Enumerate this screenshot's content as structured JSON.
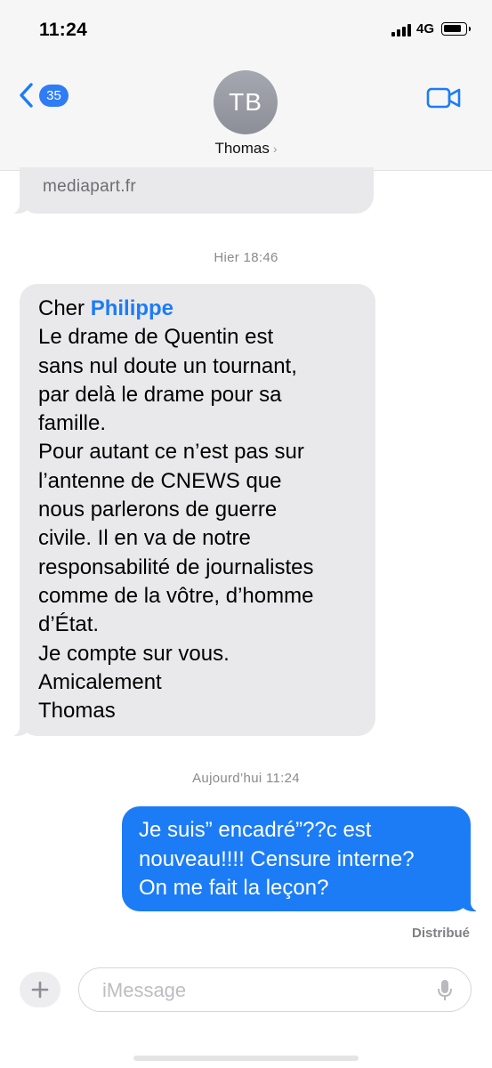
{
  "status_bar": {
    "time": "11:24",
    "network": "4G"
  },
  "header": {
    "back_count": "35",
    "avatar_initials": "TB",
    "contact_name": "Thomas",
    "chevron": "›"
  },
  "messages": {
    "previous_link": "mediapart.fr",
    "timestamp_1": "Hier 18:46",
    "msg1_greeting": "Cher ",
    "msg1_mention": "Philippe",
    "msg1_body": "Le drame de Quentin est\nsans nul doute un tournant,\npar delà le drame pour sa\nfamille.\nPour autant ce n’est pas sur\nl’antenne de CNEWS que\nnous parlerons de guerre\ncivile. Il en va de notre\nresponsabilité de journalistes\ncomme de la vôtre, d’homme\nd’État.\nJe compte sur vous.\nAmicalement\nThomas",
    "timestamp_2": "Aujourd’hui 11:24",
    "msg2_body": "Je suis” encadré”??c est\nnouveau!!!! Censure interne?\nOn me fait la leçon?",
    "delivery_status": "Distribué"
  },
  "composer": {
    "placeholder": "iMessage"
  },
  "icons": {
    "back": "chevron-left-icon",
    "video": "video-camera-icon",
    "plus": "plus-icon",
    "mic": "microphone-icon"
  },
  "colors": {
    "accent": "#1c7cf6",
    "incoming_bubble": "#e9e9eb",
    "outgoing_bubble": "#1c7cf6",
    "header_bg": "#f6f6f6",
    "timestamp": "#8a8a8e"
  }
}
